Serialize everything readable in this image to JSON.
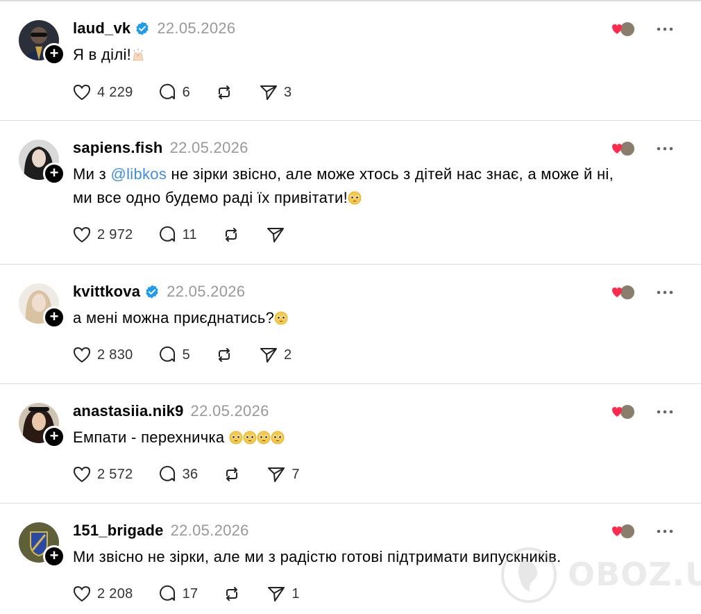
{
  "posts": [
    {
      "username": "laud_vk",
      "verified": true,
      "date": "22.05.2026",
      "text_parts": [
        "Я в ділі!"
      ],
      "emoji_after": [
        "raising-hands-icon"
      ],
      "likes": "4 229",
      "replies": "6",
      "reposts": "",
      "shares": "3"
    },
    {
      "username": "sapiens.fish",
      "verified": false,
      "date": "22.05.2026",
      "line1_pre": "Ми з ",
      "mention": "@libkos",
      "line1_post": " не зірки звісно, але може хтось з дітей нас знає, а може й ні,",
      "line2": "ми все одно будемо раді їх привітати!",
      "likes": "2 972",
      "replies": "11",
      "reposts": "",
      "shares": ""
    },
    {
      "username": "kvittkova",
      "verified": true,
      "date": "22.05.2026",
      "text": "а мені можна приєднатись?",
      "likes": "2 830",
      "replies": "5",
      "reposts": "",
      "shares": "2"
    },
    {
      "username": "anastasiia.nik9",
      "verified": false,
      "date": "22.05.2026",
      "text": "Емпати - перехничка ",
      "likes": "2 572",
      "replies": "36",
      "reposts": "",
      "shares": "7"
    },
    {
      "username": "151_brigade",
      "verified": false,
      "date": "22.05.2026",
      "text": "Ми звісно не зірки, але ми з радістю готові підтримати випускників.",
      "likes": "2 208",
      "replies": "17",
      "reposts": "",
      "shares": "1"
    }
  ],
  "watermark": "OBOZ.UA",
  "colors": {
    "mention": "#3f8ee0",
    "verified": "#1d9bf0",
    "date": "#999999",
    "divider": "#dcdcdc",
    "heart": "#ff2a4d"
  }
}
